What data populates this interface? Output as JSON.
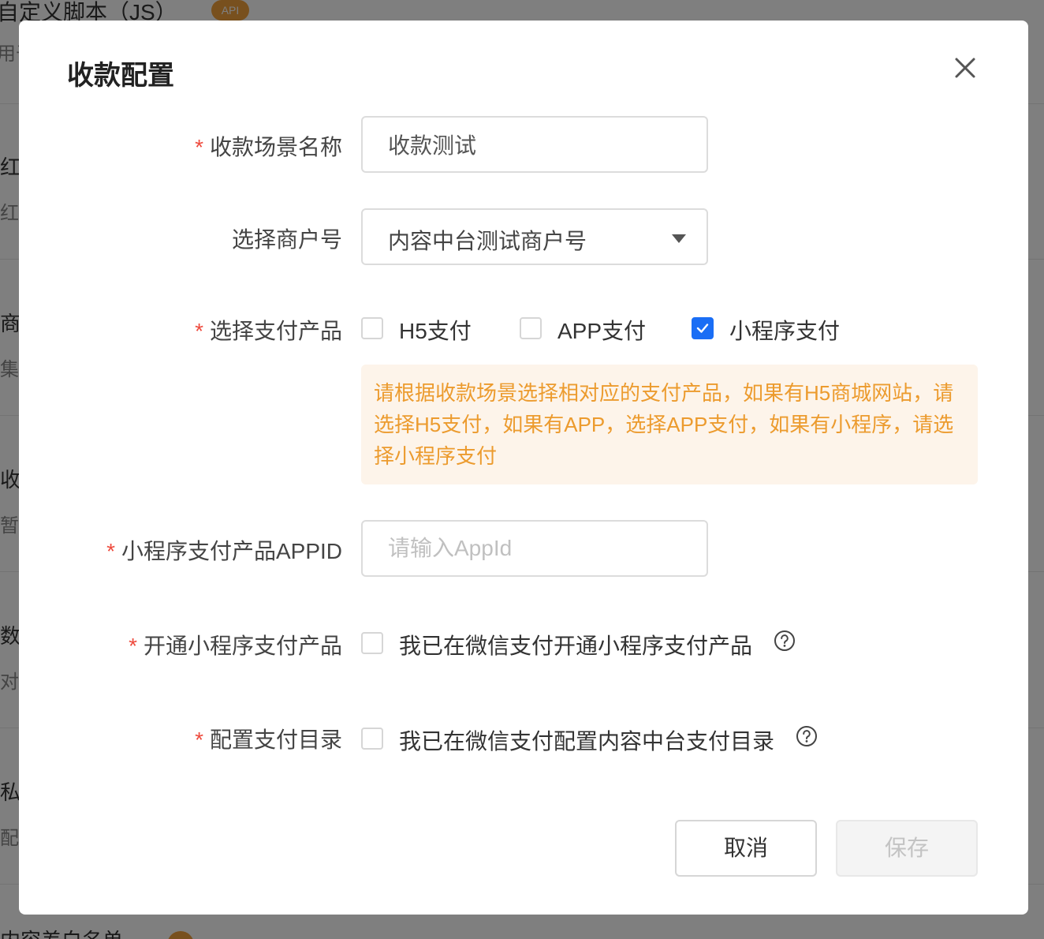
{
  "background": {
    "top_title": "自定义脚本（JS）",
    "top_desc": "用于",
    "api_badge": "API",
    "rows": [
      {
        "title": "红包",
        "desc": "红包"
      },
      {
        "title": "商城",
        "desc": "集成"
      },
      {
        "title": "收款",
        "desc": "暂时"
      },
      {
        "title": "数据",
        "desc": "对接"
      },
      {
        "title": "私有",
        "desc": "配置"
      }
    ],
    "bottom_title": "内容差白名单"
  },
  "dialog": {
    "title": "收款配置",
    "fields": {
      "scene_name": {
        "label": "收款场景名称",
        "value": "收款测试"
      },
      "merchant": {
        "label": "选择商户号",
        "value": "内容中台测试商户号"
      },
      "pay_product": {
        "label": "选择支付产品",
        "options": [
          {
            "label": "H5支付",
            "checked": false
          },
          {
            "label": "APP支付",
            "checked": false
          },
          {
            "label": "小程序支付",
            "checked": true
          }
        ],
        "hint": "请根据收款场景选择相对应的支付产品，如果有H5商城网站，请选择H5支付，如果有APP，选择APP支付，如果有小程序，请选择小程序支付"
      },
      "appid": {
        "label": "小程序支付产品APPID",
        "value": "",
        "placeholder": "请输入AppId"
      },
      "open_product": {
        "label": "开通小程序支付产品",
        "checkbox_label": "我已在微信支付开通小程序支付产品",
        "checked": false
      },
      "pay_dir": {
        "label": "配置支付目录",
        "checkbox_label": "我已在微信支付配置内容中台支付目录",
        "checked": false
      }
    },
    "required_mark": "*",
    "buttons": {
      "cancel": "取消",
      "save": "保存"
    }
  },
  "colors": {
    "primary": "#1a6ef5",
    "required": "#ee4b3e",
    "hint_text": "#ec9b2e",
    "hint_bg": "#fdf4ea"
  }
}
